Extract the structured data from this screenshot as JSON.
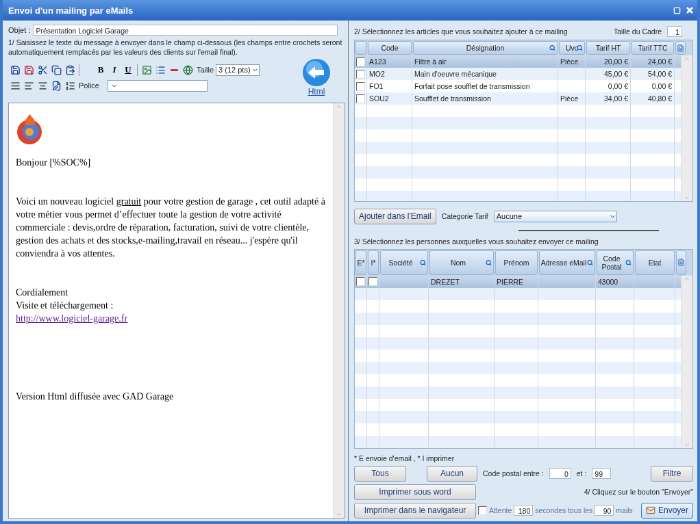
{
  "window": {
    "title": "Envoi d'un mailing par eMails"
  },
  "left": {
    "subject_label": "Objet :",
    "subject_value": "Présentation Logiciel Garage",
    "instructions": "1/ Saisissez le texte du message à envoyer dans le champ ci-dessous (les champs entre crochets seront automatiquement remplacés par les valeurs des clients sur l'email final).",
    "format_buttons": [
      "B",
      "I",
      "U"
    ],
    "size_label": "Taille",
    "size_value": "3 (12 pts)",
    "font_label": "Police",
    "html_label": "Html",
    "editor": {
      "greeting": "Bonjour [%SOC%]",
      "body_before": "Voici un nouveau logiciel ",
      "body_underlined": "gratuit",
      "body_after": " pour votre gestion de garage , cet outil adapté à votre métier vous permet d’effectuer toute la gestion de votre activité commerciale : devis,ordre de réparation, facturation, suivi de votre clientèle, gestion des achats et des stocks,e-mailing,travail en réseau... j'espère qu'il conviendra à vos attentes.",
      "closing": "Cordialement",
      "visit": "Visite et téléchargement :",
      "link": "http://www.logiciel-garage.fr",
      "footer": "Version Html diffusée avec GAD Garage"
    }
  },
  "articles": {
    "label": "2/ Sélectionnez les articles que vous souhaitez ajouter à ce mailing",
    "frame_label": "Taille du Cadre",
    "frame_value": "1",
    "columns": [
      {
        "label": "Code",
        "searchable": false
      },
      {
        "label": "Désignation",
        "searchable": true
      },
      {
        "label": "Uvc",
        "searchable": true
      },
      {
        "label": "Tarif HT",
        "searchable": false
      },
      {
        "label": "Tarif TTC",
        "searchable": false
      }
    ],
    "rows": [
      {
        "checked": false,
        "selected": true,
        "cells": [
          "A123",
          "Filtre à air",
          "Pièce",
          "20,00 €",
          "24,00 €"
        ]
      },
      {
        "checked": false,
        "selected": false,
        "cells": [
          "MO2",
          "Main d'oeuvre mécanique",
          "",
          "45,00 €",
          "54,00 €"
        ]
      },
      {
        "checked": false,
        "selected": false,
        "cells": [
          "FO1",
          "Forfait pose soufflet de transmission",
          "",
          "0,00 €",
          "0,00 €"
        ]
      },
      {
        "checked": false,
        "selected": false,
        "cells": [
          "SOU2",
          "Soufflet de transmission",
          "Pièce",
          "34,00 €",
          "40,80 €"
        ]
      }
    ],
    "add_button": "Ajouter dans l'Email",
    "category_label": "Categorie Tarif",
    "category_value": "Aucune"
  },
  "contacts": {
    "label": "3/ Sélectionnez les personnes auxquelles vous souhaitez envoyer ce mailing",
    "flag_columns": [
      {
        "label": "E*"
      },
      {
        "label": "I*"
      }
    ],
    "columns": [
      {
        "label": "Société",
        "searchable": true
      },
      {
        "label": "Nom",
        "searchable": true
      },
      {
        "label": "Prénom",
        "searchable": false
      },
      {
        "label": "Adresse eMail",
        "searchable": true
      },
      {
        "label": "Code Postal",
        "searchable": true
      },
      {
        "label": "Etat",
        "searchable": false
      }
    ],
    "rows": [
      {
        "email": false,
        "print": false,
        "selected": true,
        "cells": [
          "",
          "DREZET",
          "PIERRE",
          "",
          "43000",
          ""
        ]
      }
    ],
    "footnote": "* E envoie d'email , * I imprimer",
    "all_button": "Tous",
    "none_button": "Aucun",
    "postal_label": "Code postal  entre :",
    "postal_from": "0",
    "postal_and": "et :",
    "postal_to": "99",
    "filter_button": "Filtre",
    "print_word_button": "Imprimer sous word",
    "print_browser_button": "Imprimer dans le navigateur",
    "step4": "4/ Cliquez sur le bouton \"Envoyer\"",
    "wait": {
      "checked": false,
      "label": "Attente",
      "seconds": "180",
      "seconds_label": "secondes tous les",
      "mails": "90",
      "mails_label": "mails"
    },
    "send_button": "Envoyer"
  }
}
